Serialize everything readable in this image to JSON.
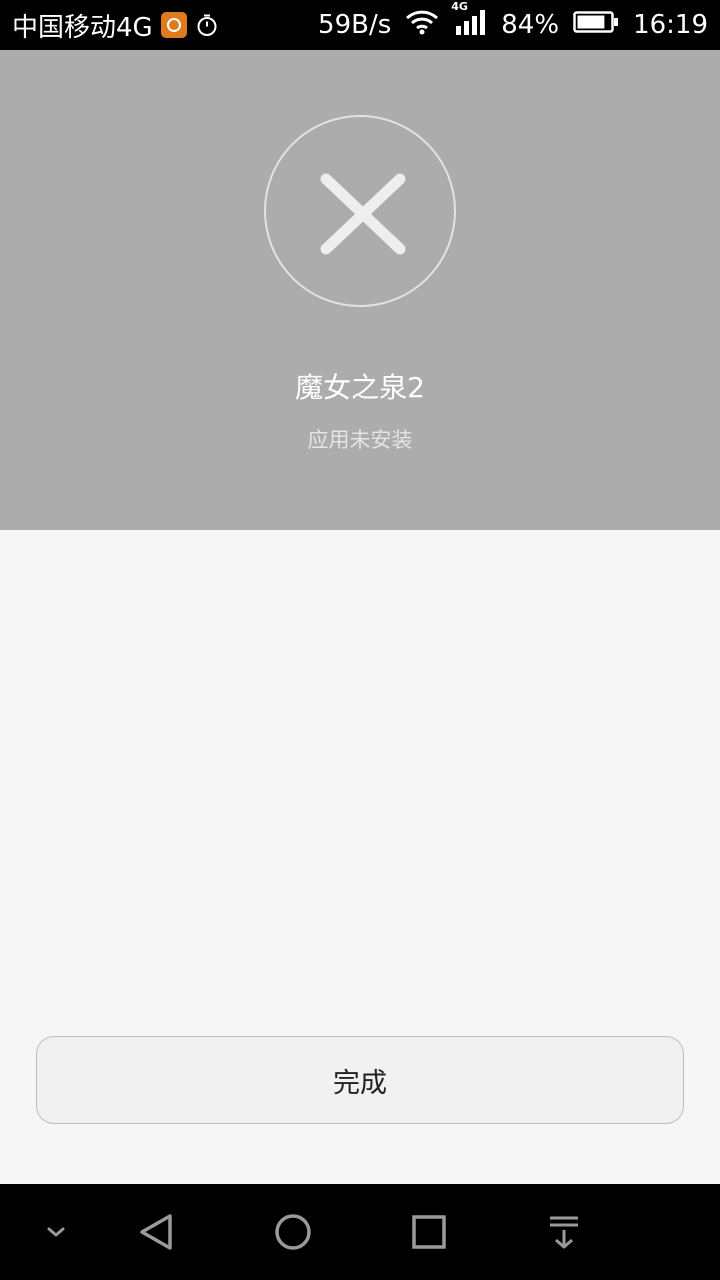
{
  "status_bar": {
    "carrier": "中国移动4G",
    "net_speed": "59B/s",
    "signal_label": "4G",
    "battery_percent": "84%",
    "time": "16:19",
    "battery_level": 0.84
  },
  "result": {
    "app_name": "魔女之泉2",
    "status_text": "应用未安装"
  },
  "actions": {
    "done_label": "完成"
  },
  "colors": {
    "header_bg": "#acacac",
    "page_bg": "#f6f6f6",
    "status_bar_bg": "#000000",
    "nav_bar_bg": "#000000"
  },
  "icons": {
    "status_app": "app-notification-icon",
    "stopwatch": "stopwatch-icon",
    "wifi": "wifi-icon",
    "signal": "signal-icon",
    "battery": "battery-icon",
    "fail": "close-icon",
    "nav_collapse": "chevron-down-icon",
    "nav_back": "back-icon",
    "nav_home": "home-icon",
    "nav_recents": "recents-icon",
    "nav_notifications": "notification-pull-icon"
  }
}
